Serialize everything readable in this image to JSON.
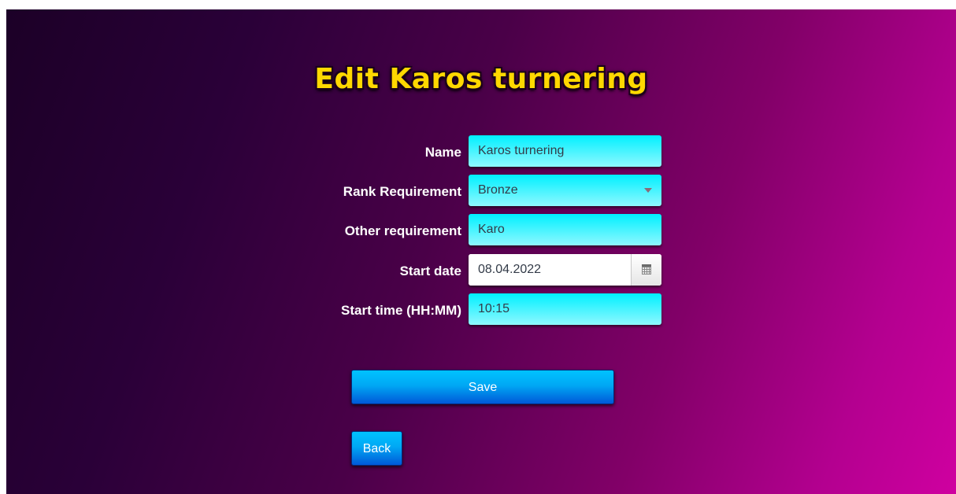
{
  "page": {
    "title": "Edit Karos turnering"
  },
  "form": {
    "name": {
      "label": "Name",
      "value": "Karos turnering"
    },
    "rank_requirement": {
      "label": "Rank Requirement",
      "value": "Bronze"
    },
    "other_requirement": {
      "label": "Other requirement",
      "value": "Karo"
    },
    "start_date": {
      "label": "Start date",
      "value": "08.04.2022",
      "icon": "calendar-icon"
    },
    "start_time": {
      "label": "Start time (HH:MM)",
      "value": "10:15"
    }
  },
  "actions": {
    "save_label": "Save",
    "back_label": "Back"
  },
  "colors": {
    "title": "#ffd800",
    "field_bg": "#00f0ff",
    "button_top": "#00c2ff",
    "button_bottom": "#0058d8",
    "background_start": "#1c0027",
    "background_end": "#cf00a0"
  }
}
